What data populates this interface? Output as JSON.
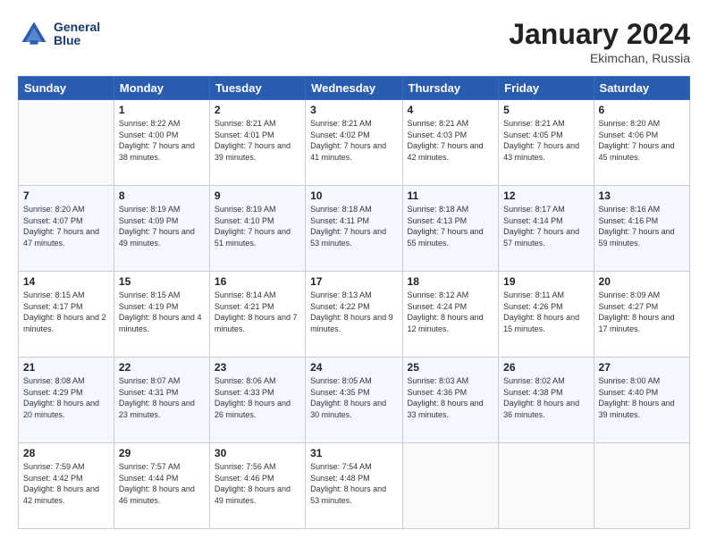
{
  "header": {
    "logo_line1": "General",
    "logo_line2": "Blue",
    "month": "January 2024",
    "location": "Ekimchan, Russia"
  },
  "weekdays": [
    "Sunday",
    "Monday",
    "Tuesday",
    "Wednesday",
    "Thursday",
    "Friday",
    "Saturday"
  ],
  "weeks": [
    [
      {
        "day": "",
        "sunrise": "",
        "sunset": "",
        "daylight": ""
      },
      {
        "day": "1",
        "sunrise": "8:22 AM",
        "sunset": "4:00 PM",
        "daylight": "7 hours and 38 minutes."
      },
      {
        "day": "2",
        "sunrise": "8:21 AM",
        "sunset": "4:01 PM",
        "daylight": "7 hours and 39 minutes."
      },
      {
        "day": "3",
        "sunrise": "8:21 AM",
        "sunset": "4:02 PM",
        "daylight": "7 hours and 41 minutes."
      },
      {
        "day": "4",
        "sunrise": "8:21 AM",
        "sunset": "4:03 PM",
        "daylight": "7 hours and 42 minutes."
      },
      {
        "day": "5",
        "sunrise": "8:21 AM",
        "sunset": "4:05 PM",
        "daylight": "7 hours and 43 minutes."
      },
      {
        "day": "6",
        "sunrise": "8:20 AM",
        "sunset": "4:06 PM",
        "daylight": "7 hours and 45 minutes."
      }
    ],
    [
      {
        "day": "7",
        "sunrise": "8:20 AM",
        "sunset": "4:07 PM",
        "daylight": "7 hours and 47 minutes."
      },
      {
        "day": "8",
        "sunrise": "8:19 AM",
        "sunset": "4:09 PM",
        "daylight": "7 hours and 49 minutes."
      },
      {
        "day": "9",
        "sunrise": "8:19 AM",
        "sunset": "4:10 PM",
        "daylight": "7 hours and 51 minutes."
      },
      {
        "day": "10",
        "sunrise": "8:18 AM",
        "sunset": "4:11 PM",
        "daylight": "7 hours and 53 minutes."
      },
      {
        "day": "11",
        "sunrise": "8:18 AM",
        "sunset": "4:13 PM",
        "daylight": "7 hours and 55 minutes."
      },
      {
        "day": "12",
        "sunrise": "8:17 AM",
        "sunset": "4:14 PM",
        "daylight": "7 hours and 57 minutes."
      },
      {
        "day": "13",
        "sunrise": "8:16 AM",
        "sunset": "4:16 PM",
        "daylight": "7 hours and 59 minutes."
      }
    ],
    [
      {
        "day": "14",
        "sunrise": "8:15 AM",
        "sunset": "4:17 PM",
        "daylight": "8 hours and 2 minutes."
      },
      {
        "day": "15",
        "sunrise": "8:15 AM",
        "sunset": "4:19 PM",
        "daylight": "8 hours and 4 minutes."
      },
      {
        "day": "16",
        "sunrise": "8:14 AM",
        "sunset": "4:21 PM",
        "daylight": "8 hours and 7 minutes."
      },
      {
        "day": "17",
        "sunrise": "8:13 AM",
        "sunset": "4:22 PM",
        "daylight": "8 hours and 9 minutes."
      },
      {
        "day": "18",
        "sunrise": "8:12 AM",
        "sunset": "4:24 PM",
        "daylight": "8 hours and 12 minutes."
      },
      {
        "day": "19",
        "sunrise": "8:11 AM",
        "sunset": "4:26 PM",
        "daylight": "8 hours and 15 minutes."
      },
      {
        "day": "20",
        "sunrise": "8:09 AM",
        "sunset": "4:27 PM",
        "daylight": "8 hours and 17 minutes."
      }
    ],
    [
      {
        "day": "21",
        "sunrise": "8:08 AM",
        "sunset": "4:29 PM",
        "daylight": "8 hours and 20 minutes."
      },
      {
        "day": "22",
        "sunrise": "8:07 AM",
        "sunset": "4:31 PM",
        "daylight": "8 hours and 23 minutes."
      },
      {
        "day": "23",
        "sunrise": "8:06 AM",
        "sunset": "4:33 PM",
        "daylight": "8 hours and 26 minutes."
      },
      {
        "day": "24",
        "sunrise": "8:05 AM",
        "sunset": "4:35 PM",
        "daylight": "8 hours and 30 minutes."
      },
      {
        "day": "25",
        "sunrise": "8:03 AM",
        "sunset": "4:36 PM",
        "daylight": "8 hours and 33 minutes."
      },
      {
        "day": "26",
        "sunrise": "8:02 AM",
        "sunset": "4:38 PM",
        "daylight": "8 hours and 36 minutes."
      },
      {
        "day": "27",
        "sunrise": "8:00 AM",
        "sunset": "4:40 PM",
        "daylight": "8 hours and 39 minutes."
      }
    ],
    [
      {
        "day": "28",
        "sunrise": "7:59 AM",
        "sunset": "4:42 PM",
        "daylight": "8 hours and 42 minutes."
      },
      {
        "day": "29",
        "sunrise": "7:57 AM",
        "sunset": "4:44 PM",
        "daylight": "8 hours and 46 minutes."
      },
      {
        "day": "30",
        "sunrise": "7:56 AM",
        "sunset": "4:46 PM",
        "daylight": "8 hours and 49 minutes."
      },
      {
        "day": "31",
        "sunrise": "7:54 AM",
        "sunset": "4:48 PM",
        "daylight": "8 hours and 53 minutes."
      },
      {
        "day": "",
        "sunrise": "",
        "sunset": "",
        "daylight": ""
      },
      {
        "day": "",
        "sunrise": "",
        "sunset": "",
        "daylight": ""
      },
      {
        "day": "",
        "sunrise": "",
        "sunset": "",
        "daylight": ""
      }
    ]
  ]
}
